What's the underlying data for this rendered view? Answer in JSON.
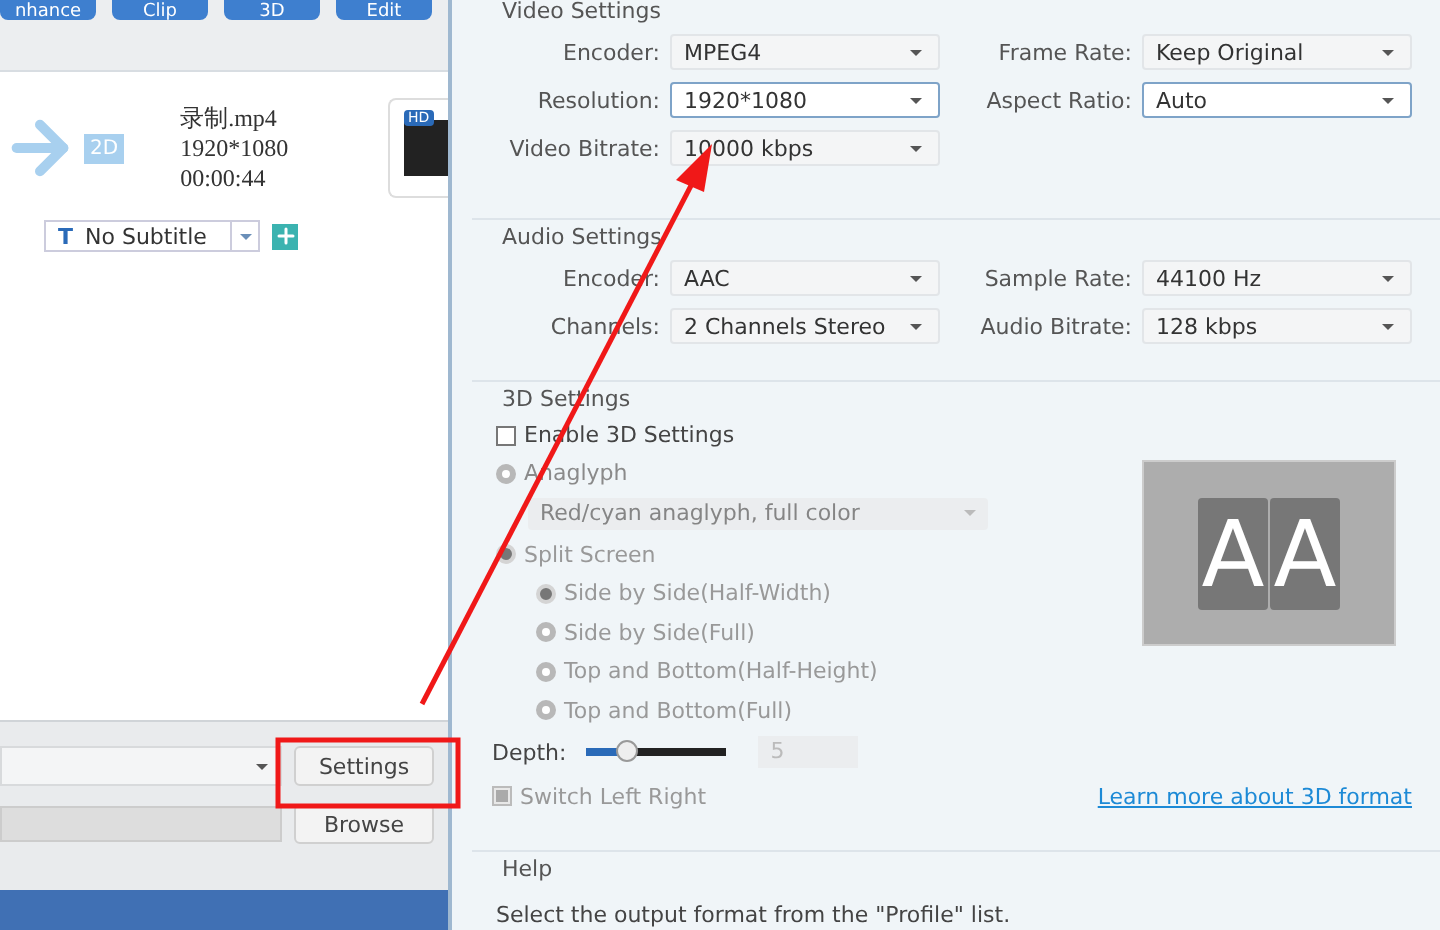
{
  "left_panel": {
    "toolbar": [
      {
        "label": "nhance"
      },
      {
        "label": "Clip"
      },
      {
        "label": "3D"
      },
      {
        "label": "Edit"
      }
    ],
    "file": {
      "badge": "2D",
      "name": "录制.mp4",
      "resolution": "1920*1080",
      "duration": "00:00:44",
      "thumbnail_badge": "HD"
    },
    "subtitle": {
      "icon": "T",
      "value": "No Subtitle"
    },
    "settings_button": "Settings",
    "browse_button": "Browse"
  },
  "video_settings": {
    "title": "Video Settings",
    "fields": [
      {
        "label": "Encoder:",
        "value": "MPEG4",
        "focused": false
      },
      {
        "label": "Frame Rate:",
        "value": "Keep Original",
        "focused": false
      },
      {
        "label": "Resolution:",
        "value": "1920*1080",
        "focused": true
      },
      {
        "label": "Aspect Ratio:",
        "value": "Auto",
        "focused": true
      },
      {
        "label": "Video Bitrate:",
        "value": "10000 kbps",
        "focused": false
      }
    ]
  },
  "audio_settings": {
    "title": "Audio Settings",
    "fields": [
      {
        "label": "Encoder:",
        "value": "AAC",
        "focused": false
      },
      {
        "label": "Sample Rate:",
        "value": "44100 Hz",
        "focused": false
      },
      {
        "label": "Channels:",
        "value": "2 Channels Stereo",
        "focused": false
      },
      {
        "label": "Audio Bitrate:",
        "value": "128 kbps",
        "focused": false
      }
    ]
  },
  "settings_3d": {
    "title": "3D Settings",
    "enable": {
      "label": "Enable 3D Settings",
      "checked": false
    },
    "anaglyph": {
      "label": "Anaglyph",
      "selected": false,
      "disabled": true
    },
    "anaglyph_type": {
      "value": "Red/cyan anaglyph, full color",
      "disabled": true
    },
    "split_screen": {
      "label": "Split Screen",
      "selected": true,
      "disabled": true
    },
    "split_options": [
      {
        "label": "Side by Side(Half-Width)",
        "selected": true
      },
      {
        "label": "Side by Side(Full)",
        "selected": false
      },
      {
        "label": "Top and Bottom(Half-Height)",
        "selected": false
      },
      {
        "label": "Top and Bottom(Full)",
        "selected": false
      }
    ],
    "depth": {
      "label": "Depth:",
      "level": 0.28,
      "value": "5"
    },
    "switch_left_right": {
      "label": "Switch Left Right",
      "checked": true,
      "disabled": true
    },
    "preview": [
      "A",
      "A"
    ],
    "learn_more": "Learn more about 3D format"
  },
  "help": {
    "title": "Help",
    "text": "Select the output format from the \"Profile\" list."
  }
}
